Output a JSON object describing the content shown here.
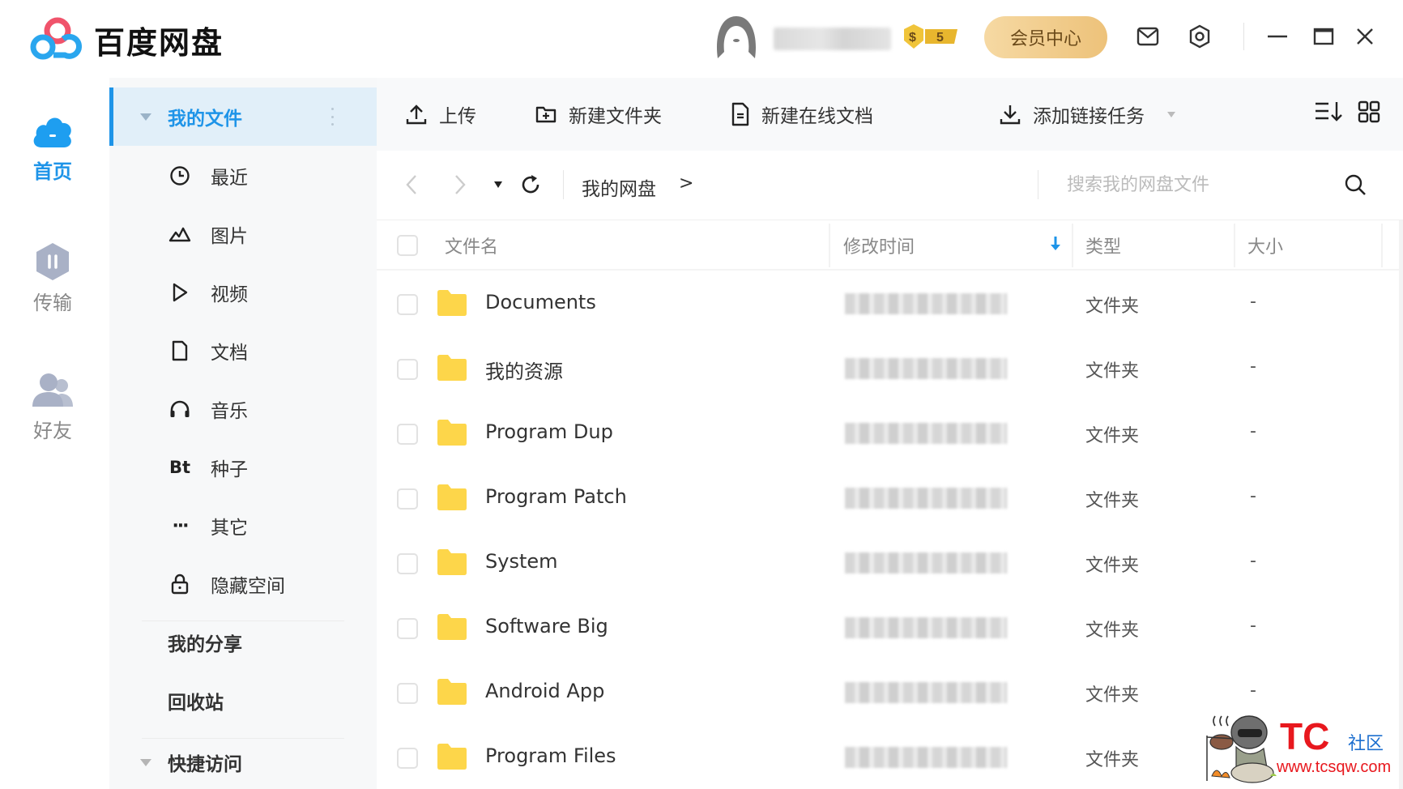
{
  "header": {
    "app_title": "百度网盘",
    "username": "",
    "vip_badge": "$ 5",
    "vip_center_label": "会员中心",
    "icons": [
      "mail-icon",
      "settings-icon",
      "minimize-icon",
      "maximize-icon",
      "close-icon"
    ]
  },
  "leftnav": {
    "items": [
      {
        "label": "首页",
        "icon": "cloud-home-icon",
        "active": true
      },
      {
        "label": "传输",
        "icon": "transfer-icon",
        "active": false
      },
      {
        "label": "好友",
        "icon": "friends-icon",
        "active": false
      }
    ]
  },
  "sidebar": {
    "my_files": "我的文件",
    "items": [
      {
        "label": "最近",
        "icon": "clock-icon"
      },
      {
        "label": "图片",
        "icon": "image-icon"
      },
      {
        "label": "视频",
        "icon": "play-icon"
      },
      {
        "label": "文档",
        "icon": "document-icon"
      },
      {
        "label": "音乐",
        "icon": "headphones-icon"
      },
      {
        "label": "种子",
        "icon": "bt-icon",
        "glyph": "Bt"
      },
      {
        "label": "其它",
        "icon": "more-icon",
        "glyph": "···"
      },
      {
        "label": "隐藏空间",
        "icon": "lock-icon"
      }
    ],
    "my_share": "我的分享",
    "recycle_bin": "回收站",
    "quick_access": "快捷访问"
  },
  "toolbar": {
    "upload": "上传",
    "new_folder": "新建文件夹",
    "new_online_doc": "新建在线文档",
    "add_link_task": "添加链接任务"
  },
  "navbar": {
    "breadcrumb": "我的网盘",
    "breadcrumb_sep": ">",
    "search_placeholder": "搜索我的网盘文件"
  },
  "table": {
    "columns": {
      "name": "文件名",
      "modified": "修改时间",
      "type": "类型",
      "size": "大小"
    },
    "sort": {
      "column": "modified",
      "direction": "desc"
    },
    "rows": [
      {
        "name": "Documents",
        "type": "文件夹",
        "size": "-"
      },
      {
        "name": "我的资源",
        "type": "文件夹",
        "size": "-"
      },
      {
        "name": "Program Dup",
        "type": "文件夹",
        "size": "-"
      },
      {
        "name": "Program Patch",
        "type": "文件夹",
        "size": "-"
      },
      {
        "name": "System",
        "type": "文件夹",
        "size": "-"
      },
      {
        "name": "Software Big",
        "type": "文件夹",
        "size": "-"
      },
      {
        "name": "Android App",
        "type": "文件夹",
        "size": "-"
      },
      {
        "name": "Program Files",
        "type": "文件夹",
        "size": "-"
      }
    ]
  },
  "watermark": {
    "brand": "TC",
    "suffix": "社区",
    "url": "www.tcsqw.com"
  },
  "colors": {
    "accent": "#1e94e8",
    "folder": "#fdd64a",
    "vip_gold": "#edc27a",
    "sidebar_bg": "#f7f8f9",
    "selected_bg": "#e1eff9"
  }
}
